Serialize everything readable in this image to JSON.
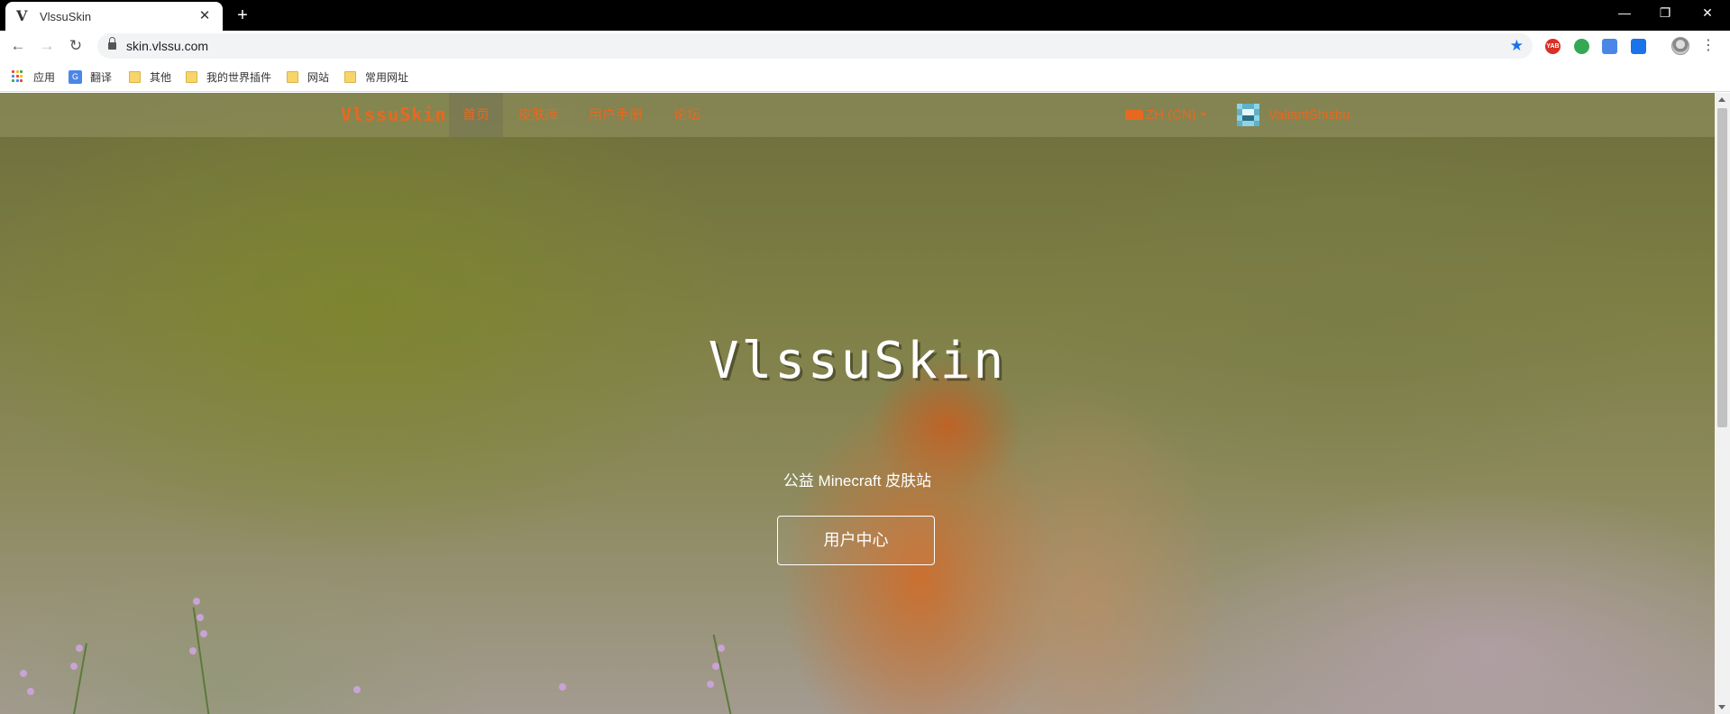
{
  "browser": {
    "tab": {
      "title": "VlssuSkin",
      "favicon": "V",
      "close": "✕"
    },
    "new_tab": "+",
    "window": {
      "minimize": "—",
      "restore": "❐",
      "close": "✕"
    },
    "toolbar": {
      "back": "←",
      "forward": "→",
      "reload": "↻",
      "url": "skin.vlssu.com",
      "bookmark_star": "★",
      "menu": "⋮"
    },
    "extensions": [
      {
        "icon": "yabi-icon",
        "label": "YAB",
        "color": "#d93025"
      },
      {
        "icon": "shield-extension-icon",
        "label": "",
        "color": "#34a853"
      },
      {
        "icon": "translate-extension-icon",
        "label": "",
        "color": "#4a86e8"
      },
      {
        "icon": "share-extension-icon",
        "label": "",
        "color": "#1a73e8"
      }
    ],
    "bookmarks": [
      {
        "icon": "apps-grid-icon",
        "label": "应用"
      },
      {
        "icon": "translate-icon",
        "label": "翻译"
      },
      {
        "icon": "folder-icon",
        "label": "其他"
      },
      {
        "icon": "folder-icon",
        "label": "我的世界插件"
      },
      {
        "icon": "folder-icon",
        "label": "网站"
      },
      {
        "icon": "folder-icon",
        "label": "常用网址"
      }
    ]
  },
  "site": {
    "brand": "VlssuSkin",
    "nav": [
      {
        "label": "首页",
        "active": true
      },
      {
        "label": "皮肤库",
        "active": false
      },
      {
        "label": "用户手册",
        "active": false
      },
      {
        "label": "论坛",
        "active": false
      }
    ],
    "language": "ZH (CN)",
    "username": "ValiantShishu",
    "accent_color": "#e8681f"
  },
  "hero": {
    "title": "VlssuSkin",
    "subtitle": "公益 Minecraft 皮肤站",
    "button": "用户中心"
  }
}
